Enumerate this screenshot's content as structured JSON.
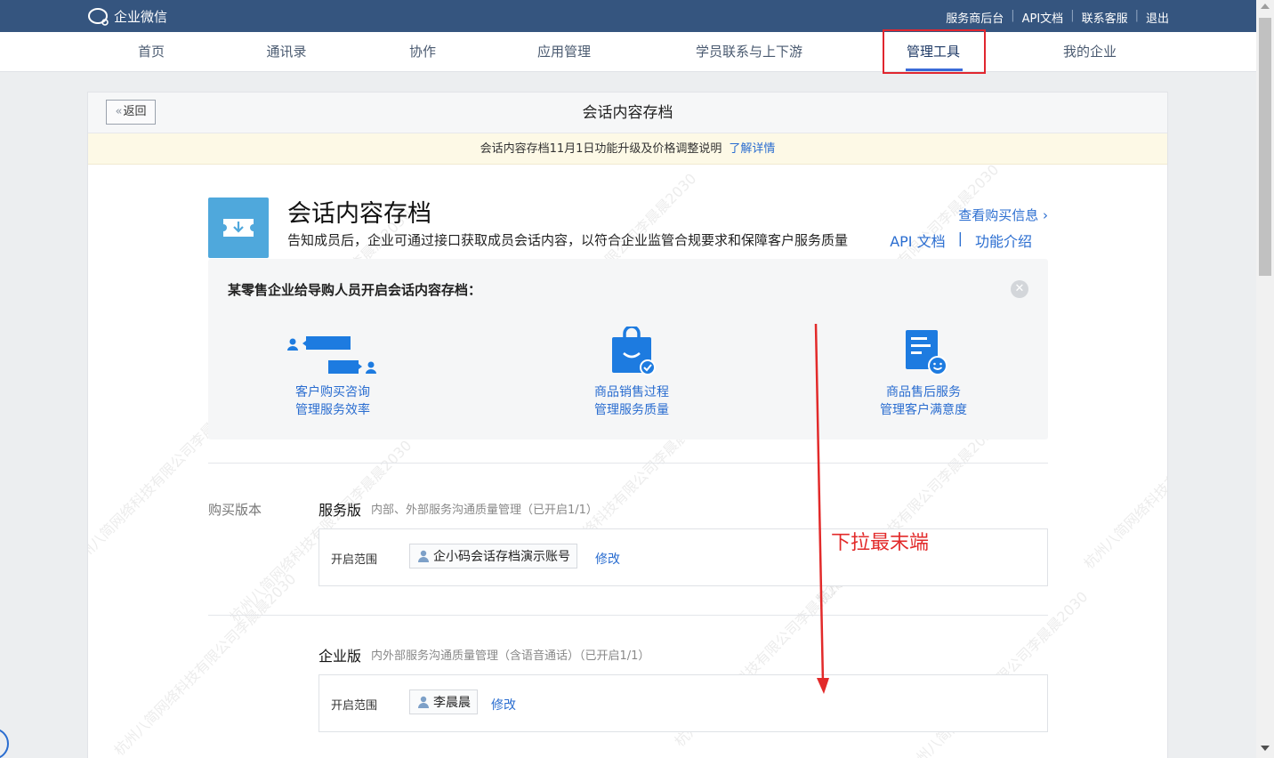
{
  "topbar": {
    "logo_text": "企业微信",
    "links": [
      "服务商后台",
      "API文档",
      "联系客服",
      "退出"
    ]
  },
  "nav": {
    "items": [
      "首页",
      "通讯录",
      "协作",
      "应用管理",
      "学员联系与上下游",
      "管理工具",
      "我的企业"
    ],
    "active": "管理工具"
  },
  "page": {
    "back_label": "返回",
    "title": "会话内容存档"
  },
  "notice": {
    "text": "会话内容存档11月1日功能升级及价格调整说明",
    "link": "了解详情"
  },
  "app": {
    "title": "会话内容存档",
    "description": "告知成员后，企业可通过接口获取成员会话内容，以符合企业监管合规要求和保障客户服务质量",
    "buy_info": "查看购买信息",
    "api_doc": "API 文档",
    "feature_intro": "功能介绍",
    "sep": "|"
  },
  "example": {
    "title": "某零售企业给导购人员开启会话内容存档：",
    "close_icon": "close-circle-icon",
    "features": [
      {
        "icon": "chat-bubbles-icon",
        "line1": "客户购买咨询",
        "line2": "管理服务效率"
      },
      {
        "icon": "shopping-bag-icon",
        "line1": "商品销售过程",
        "line2": "管理服务质量"
      },
      {
        "icon": "document-smile-icon",
        "line1": "商品售后服务",
        "line2": "管理客户满意度"
      }
    ]
  },
  "purchase": {
    "section_label": "购买版本",
    "plans": [
      {
        "name": "服务版",
        "desc": "内部、外部服务沟通质量管理（已开启1/1）",
        "scope_label": "开启范围",
        "member": "企小码会话存档演示账号",
        "modify": "修改"
      },
      {
        "name": "企业版",
        "desc": "内外部服务沟通质量管理（含语音通话）（已开启1/1）",
        "scope_label": "开启范围",
        "member": "李晨晨",
        "modify": "修改"
      }
    ]
  },
  "annotation": {
    "text": "下拉最末端"
  },
  "watermark": "杭州八简网络科技有限公司李晨晨2030",
  "colors": {
    "topbar": "#35557f",
    "link": "#2a6dd0",
    "annotation": "#e22a2a",
    "app_icon": "#4fa8dc"
  }
}
